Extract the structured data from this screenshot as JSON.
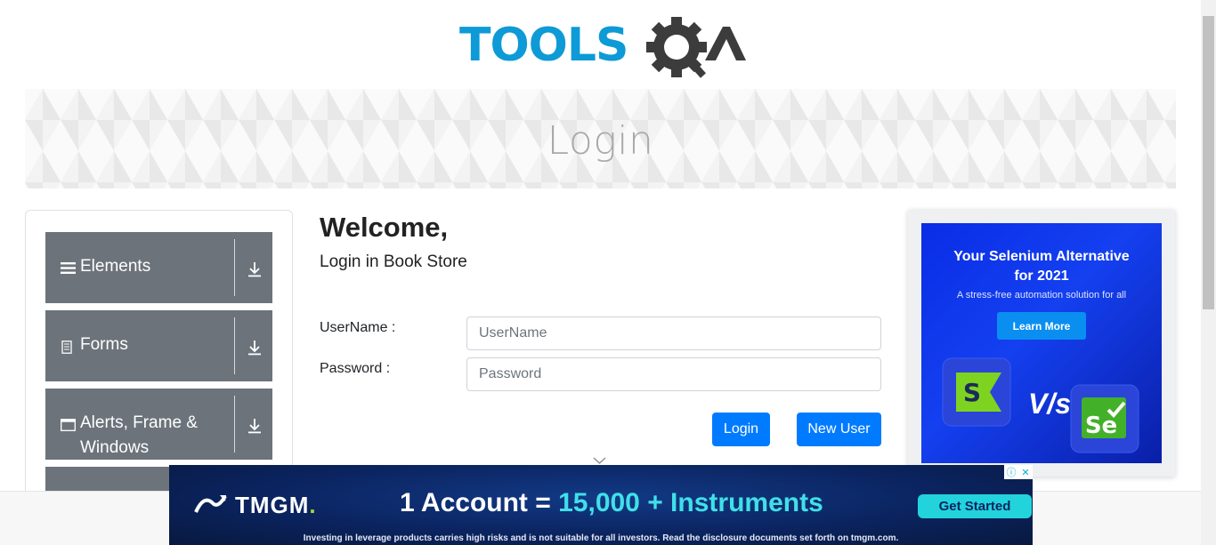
{
  "header": {
    "logo_text_left": "TOOLS",
    "logo_text_right": "QA"
  },
  "banner": {
    "title": "Login"
  },
  "sidebar": {
    "groups": [
      {
        "label": "Elements",
        "icon": "hamburger-icon"
      },
      {
        "label": "Forms",
        "icon": "document-icon"
      },
      {
        "label_line1": "Alerts, Frame &",
        "label_line2": "Windows",
        "icon": "window-icon"
      }
    ]
  },
  "form": {
    "welcome": "Welcome,",
    "subtitle": "Login in Book Store",
    "username_label": "UserName :",
    "username_placeholder": "UserName",
    "password_label": "Password :",
    "password_placeholder": "Password",
    "login_button": "Login",
    "new_user_button": "New User"
  },
  "side_ad": {
    "title_line1": "Your Selenium Alternative",
    "title_line2": "for 2021",
    "subtitle": "A stress-free automation solution for all",
    "cta": "Learn More",
    "vs_text": "V/s"
  },
  "bottom_ad": {
    "brand": "TMGM",
    "brand_dot": ".",
    "headline_part1": "1 Account = ",
    "headline_part2": "15,000 + Instruments",
    "cta": "Get Started",
    "disclaimer": "Investing in leverage products carries high risks and is not suitable for all investors. Read the disclosure documents set forth on tmgm.com."
  },
  "colors": {
    "logo_blue": "#0d9ad7",
    "logo_dark": "#3c3c3c",
    "sidebar_bg": "#6c737b",
    "primary_button": "#007bff",
    "banner_title": "#a9a9a9"
  }
}
